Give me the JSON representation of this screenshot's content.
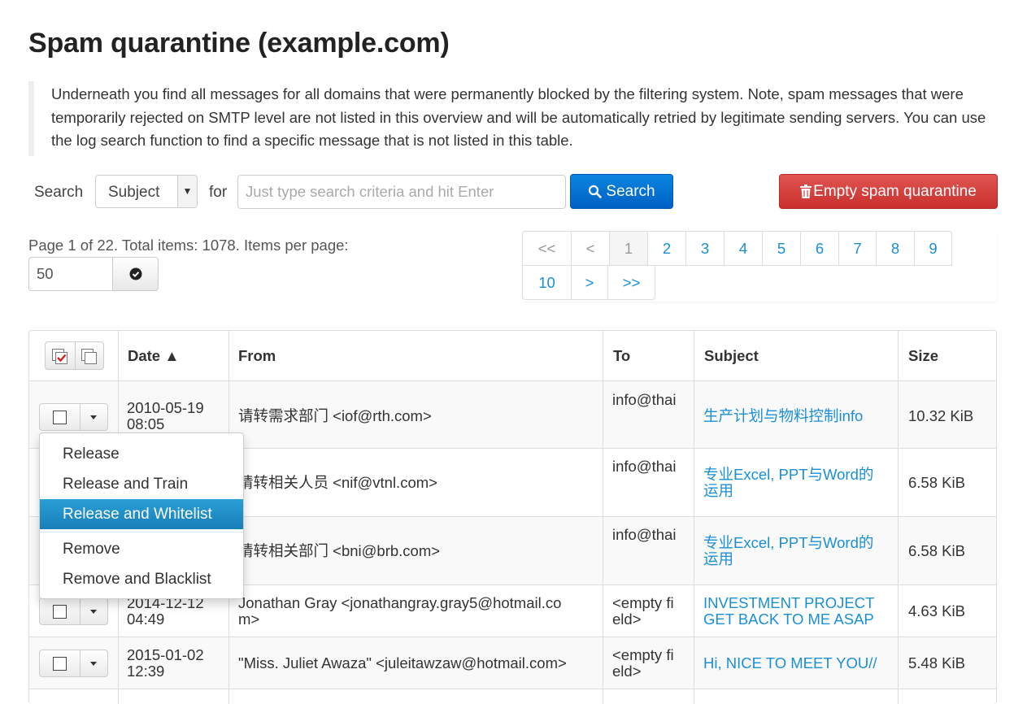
{
  "page": {
    "title": "Spam quarantine (example.com)",
    "intro": "Underneath you find all messages for all domains that were permanently blocked by the filtering system. Note, spam messages that were temporarily rejected on SMTP level are not listed in this overview and will be automatically retried by legitimate sending servers. You can use the log search function to find a specific message that is not listed in this table."
  },
  "search": {
    "label": "Search",
    "field_value": "Subject",
    "for_label": "for",
    "placeholder": "Just type search criteria and hit Enter",
    "button": "Search",
    "empty_button": "Empty spam quarantine"
  },
  "pagination": {
    "info": "Page 1 of 22. Total items: 1078. Items per page:",
    "per_page": "50",
    "pages": [
      "<<",
      "<",
      "1",
      "2",
      "3",
      "4",
      "5",
      "6",
      "7",
      "8",
      "9",
      "10",
      ">",
      ">>"
    ],
    "current": "1"
  },
  "table": {
    "headers": {
      "date": "Date ▲",
      "from": "From",
      "to": "To",
      "subject": "Subject",
      "size": "Size"
    },
    "rows": [
      {
        "date": [
          "2010-05-19",
          "08:05"
        ],
        "from": "请转需求部门 <iof@rth.com>",
        "to": [
          "info@thai"
        ],
        "subject": [
          "生产计划与物料控制info"
        ],
        "size": "10.32 KiB"
      },
      {
        "date": [
          "",
          ""
        ],
        "from": "请转相关人员 <nif@vtnl.com>",
        "to": [
          "info@thai"
        ],
        "subject": [
          "专业Excel, PPT与Word的",
          "运用"
        ],
        "size": "6.58 KiB"
      },
      {
        "date": [
          "",
          ""
        ],
        "from": "请转相关部门 <bni@brb.com>",
        "to": [
          "info@thai"
        ],
        "subject": [
          "专业Excel, PPT与Word的",
          "运用"
        ],
        "size": "6.58 KiB"
      },
      {
        "date": [
          "2014-12-12",
          "04:49"
        ],
        "from": "Jonathan Gray <jonathangray.gray5@hotmail.co\nm>",
        "to": [
          "<empty fi",
          "eld>"
        ],
        "subject": [
          "INVESTMENT PROJECT",
          "GET BACK TO ME ASAP"
        ],
        "size": "4.63 KiB"
      },
      {
        "date": [
          "2015-01-02",
          "12:39"
        ],
        "from": "\"Miss. Juliet Awaza\" <juleitawzaw@hotmail.com>",
        "to": [
          "<empty fi",
          "eld>"
        ],
        "subject": [
          "Hi, NICE TO MEET YOU//"
        ],
        "size": "5.48 KiB"
      }
    ]
  },
  "row_menu": {
    "items": [
      "Release",
      "Release and Train",
      "Release and Whitelist",
      "Remove",
      "Remove and Blacklist"
    ],
    "highlighted": "Release and Whitelist"
  },
  "colors": {
    "primary": "#0a75d6",
    "danger": "#d9534f",
    "link": "#1a8fd6",
    "menu_highlight": "#2289c4"
  }
}
